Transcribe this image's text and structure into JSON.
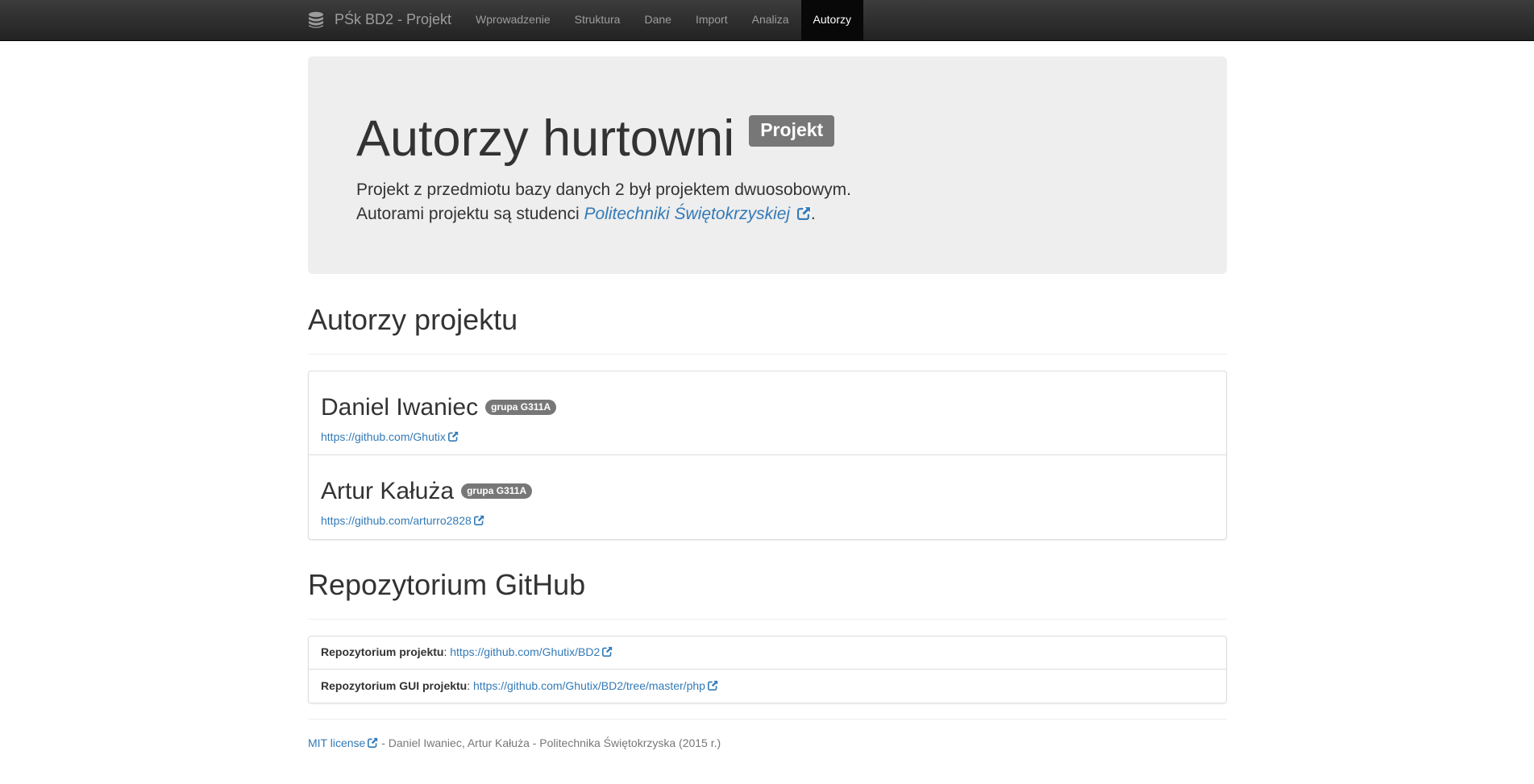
{
  "navbar": {
    "brand": "PŚk BD2 - Projekt",
    "brand_icon": "database-icon",
    "items": [
      {
        "label": "Wprowadzenie",
        "active": false
      },
      {
        "label": "Struktura",
        "active": false
      },
      {
        "label": "Dane",
        "active": false
      },
      {
        "label": "Import",
        "active": false
      },
      {
        "label": "Analiza",
        "active": false
      },
      {
        "label": "Autorzy",
        "active": true
      }
    ]
  },
  "jumbotron": {
    "title": "Autorzy hurtowni",
    "title_badge": "Projekt",
    "lead1_prefix": "Projekt z przedmiotu ",
    "lead1_bold": "bazy danych 2",
    "lead1_suffix": " był projektem dwuosobowym.",
    "lead2_prefix": "Autorami projektu są studenci ",
    "lead2_link": "Politechniki Świętokrzyskiej",
    "lead2_suffix": "."
  },
  "authors_section": {
    "heading": "Autorzy projektu",
    "authors": [
      {
        "name": "Daniel Iwaniec",
        "group": "grupa G311A",
        "url": "https://github.com/Ghutix"
      },
      {
        "name": "Artur Kałuża",
        "group": "grupa G311A",
        "url": "https://github.com/arturro2828"
      }
    ]
  },
  "repo_section": {
    "heading": "Repozytorium GitHub",
    "items": [
      {
        "label": "Repozytorium projektu",
        "url": "https://github.com/Ghutix/BD2"
      },
      {
        "label": "Repozytorium GUI projektu",
        "url": "https://github.com/Ghutix/BD2/tree/master/php"
      }
    ]
  },
  "footer": {
    "license_link": "MIT license",
    "text": " - Daniel Iwaniec, Artur Kałuża - Politechnika Świętokrzyska (2015 r.)"
  },
  "colors": {
    "link": "#337ab7",
    "navbar_bg": "#222222",
    "label_bg": "#777777",
    "jumbotron_bg": "#eeeeee"
  }
}
